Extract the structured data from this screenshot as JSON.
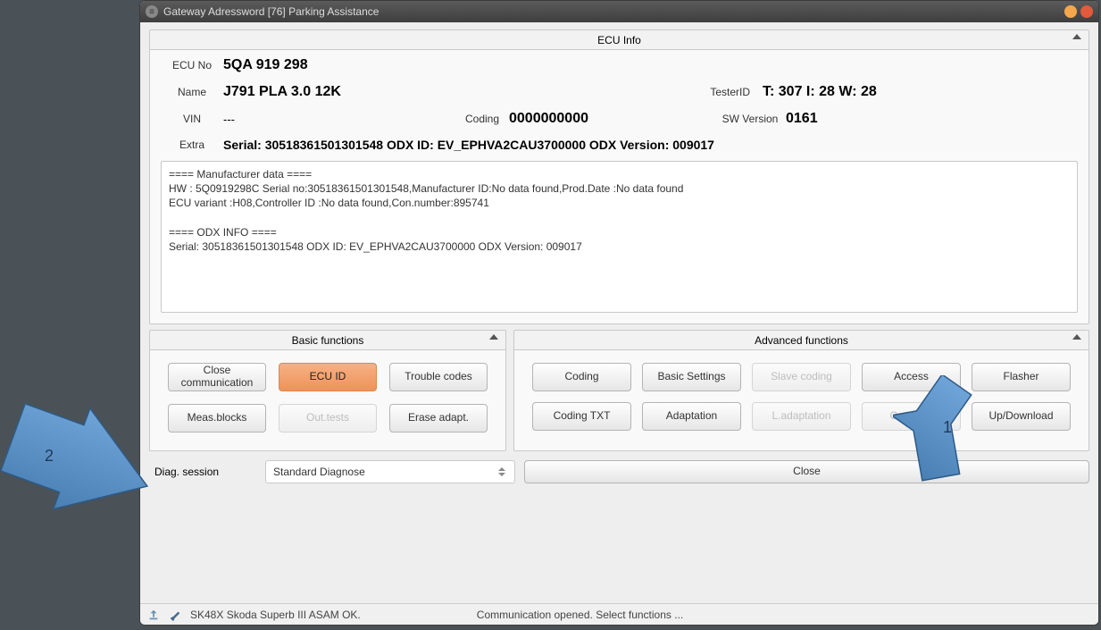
{
  "window": {
    "title": "Gateway Adressword [76] Parking Assistance"
  },
  "ecu_info": {
    "title": "ECU Info",
    "labels": {
      "ecu_no": "ECU No",
      "name": "Name",
      "vin": "VIN",
      "coding": "Coding",
      "tester_id": "TesterID",
      "sw_version": "SW Version",
      "extra": "Extra"
    },
    "ecu_no": "5QA 919 298",
    "name": "J791  PLA 3.0 12K",
    "vin": "---",
    "coding": "0000000000",
    "tester_id": "T: 307 I: 28 W: 28",
    "sw_version": "0161",
    "extra": "Serial: 30518361501301548 ODX ID: EV_EPHVA2CAU3700000 ODX Version: 009017",
    "dump": "==== Manufacturer data ====\nHW : 5Q0919298C Serial no:30518361501301548,Manufacturer ID:No data found,Prod.Date :No data found\nECU variant :H08,Controller ID :No data found,Con.number:895741\n\n==== ODX INFO ====\nSerial: 30518361501301548 ODX ID: EV_EPHVA2CAU3700000 ODX Version: 009017"
  },
  "basic": {
    "title": "Basic functions",
    "close_comm": "Close communication",
    "ecu_id": "ECU ID",
    "trouble_codes": "Trouble codes",
    "meas_blocks": "Meas.blocks",
    "out_tests": "Out.tests",
    "erase_adapt": "Erase adapt."
  },
  "advanced": {
    "title": "Advanced functions",
    "coding": "Coding",
    "basic_settings": "Basic Settings",
    "slave_coding": "Slave coding",
    "access": "Access",
    "flasher": "Flasher",
    "coding_txt": "Coding TXT",
    "adaptation": "Adaptation",
    "l_adaptation": "L.adaptation",
    "coding_ii": "Coding II",
    "up_download": "Up/Download"
  },
  "session": {
    "label": "Diag. session",
    "value": "Standard Diagnose"
  },
  "close_button": "Close",
  "status": {
    "vehicle": "SK48X Skoda Superb III ASAM OK.",
    "message": "Communication opened. Select functions ..."
  },
  "callouts": {
    "a1": "1",
    "a2": "2"
  }
}
